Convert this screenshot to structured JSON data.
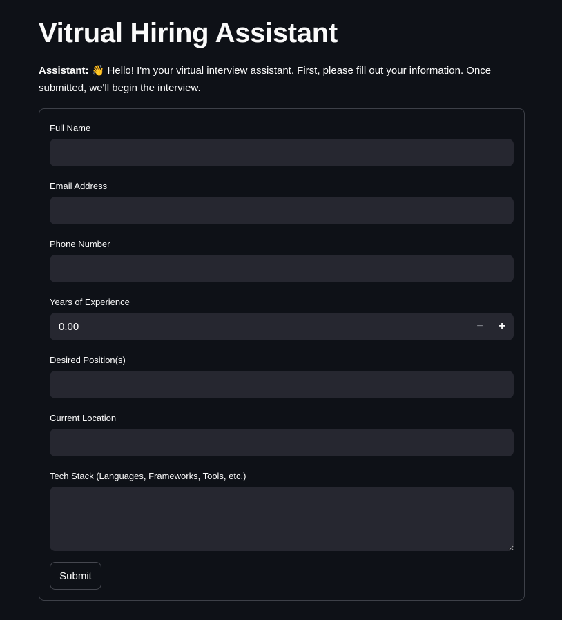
{
  "page": {
    "title": "Vitrual Hiring Assistant"
  },
  "intro": {
    "speaker": "Assistant:",
    "emoji": "👋",
    "message": " Hello! I'm your virtual interview assistant. First, please fill out your information. Once submitted, we'll begin the interview."
  },
  "form": {
    "full_name": {
      "label": "Full Name",
      "value": ""
    },
    "email": {
      "label": "Email Address",
      "value": ""
    },
    "phone": {
      "label": "Phone Number",
      "value": ""
    },
    "experience": {
      "label": "Years of Experience",
      "value": "0.00",
      "minus": "−",
      "plus": "+"
    },
    "position": {
      "label": "Desired Position(s)",
      "value": ""
    },
    "location": {
      "label": "Current Location",
      "value": ""
    },
    "tech_stack": {
      "label": "Tech Stack (Languages, Frameworks, Tools, etc.)",
      "value": ""
    },
    "submit_label": "Submit"
  },
  "colors": {
    "background": "#0e1117",
    "input_background": "#262730",
    "text": "#fafafa",
    "border": "#3d4048"
  }
}
